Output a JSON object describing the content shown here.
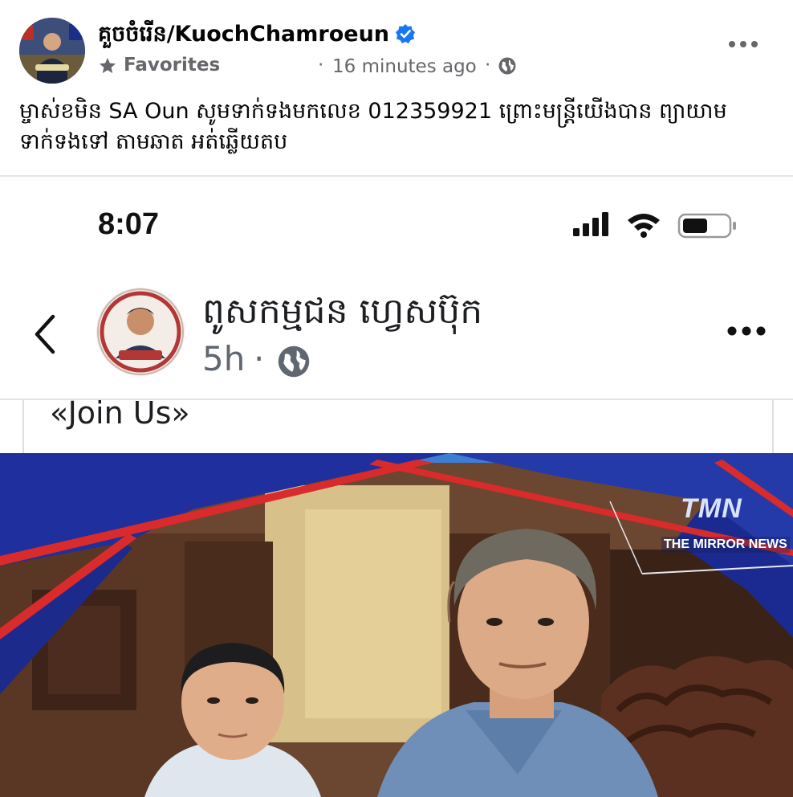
{
  "post": {
    "author": "គួចចំរើន/KuochChamroeun",
    "audience": "Favorites",
    "separator": "·",
    "timestamp": "16 minutes ago",
    "caption": "ម្ចាស់ខមិន SA Oun សូមទាក់ទងមកលេខ 012359921 ព្រោះមន្ត្រីយើងបាន ព្យាយាមទាក់ទងទៅ តាមឆាត អត់ឆ្លើយតប",
    "icons": [
      "verified-badge-icon",
      "star-icon",
      "globe-icon",
      "more-options-icon"
    ],
    "colors": {
      "verified": "#1877f2",
      "meta_text": "#65676b"
    }
  },
  "screenshot": {
    "status_bar": {
      "time": "8:07",
      "icons": [
        "signal-icon",
        "wifi-icon",
        "battery-icon"
      ]
    },
    "page": {
      "name": "ពូសកម្មជន ហ្វេសប៊ុក",
      "age": "5h",
      "separator": "·",
      "icons": [
        "back-icon",
        "globe-icon",
        "more-options-icon"
      ]
    },
    "post_text": "«Join Us»",
    "news_image": {
      "logo": "TMN",
      "logo_caption": "THE MIRROR NEWS",
      "colors": {
        "banner_blue": "#1f2f9e",
        "banner_red": "#d92b2b",
        "wall": "#d8c08a"
      }
    }
  }
}
